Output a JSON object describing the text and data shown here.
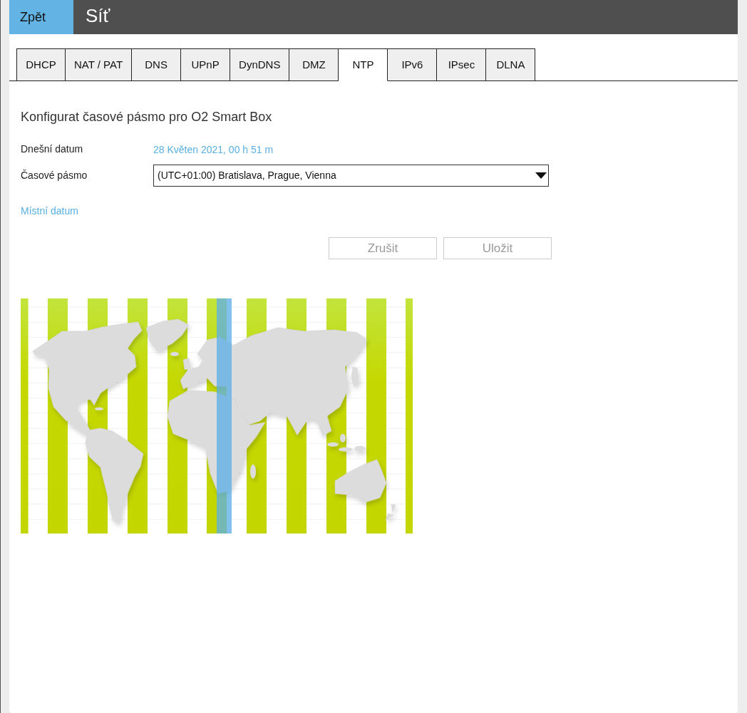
{
  "header": {
    "back_button": "Zpět",
    "title": "Síť"
  },
  "tabs": [
    {
      "label": "DHCP",
      "selected": false
    },
    {
      "label": "NAT / PAT",
      "selected": false
    },
    {
      "label": "DNS",
      "selected": false
    },
    {
      "label": "UPnP",
      "selected": false
    },
    {
      "label": "DynDNS",
      "selected": false
    },
    {
      "label": "DMZ",
      "selected": false
    },
    {
      "label": "NTP",
      "selected": true
    },
    {
      "label": "IPv6",
      "selected": false
    },
    {
      "label": "IPsec",
      "selected": false
    },
    {
      "label": "DLNA",
      "selected": false
    }
  ],
  "section": {
    "title": "Konfigurat časové pásmo pro O2 Smart Box",
    "fields": [
      {
        "kind": "text",
        "label": "Dnešní datum",
        "value": "28 Květen 2021, 00 h 51 m"
      },
      {
        "kind": "select",
        "label": "Časové pásmo",
        "value": "(UTC+01:00) Bratislava, Prague, Vienna"
      }
    ],
    "link": "Místní datum",
    "buttons": [
      {
        "label": "Zrušit",
        "disabled": true
      },
      {
        "label": "Uložit",
        "disabled": true
      }
    ]
  }
}
